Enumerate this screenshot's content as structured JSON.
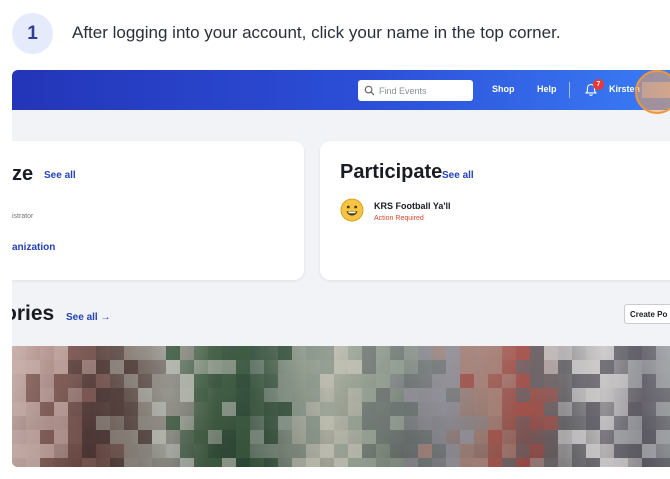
{
  "step": {
    "number": "1",
    "instruction": "After logging into your account, click your name in the top corner."
  },
  "topbar": {
    "search_placeholder": "Find Events",
    "shop_label": "Shop",
    "help_label": "Help",
    "notification_count": "7",
    "user_name": "Kirsten"
  },
  "organize": {
    "title": "ze",
    "see_all": "See all",
    "role_text": "istrator",
    "org_link": "anization"
  },
  "participate": {
    "title": "Participate",
    "see_all": "See all",
    "team_name": "KRS Football Ya'll",
    "team_status": "Action Required"
  },
  "stories": {
    "title": "ories",
    "see_all": "See all →",
    "create_label": "Create Po"
  },
  "colors": {
    "brand_blue": "#2335b8",
    "link_blue": "#2342b8",
    "alert_red": "#d84a2c",
    "highlight_orange": "#f0963c"
  }
}
